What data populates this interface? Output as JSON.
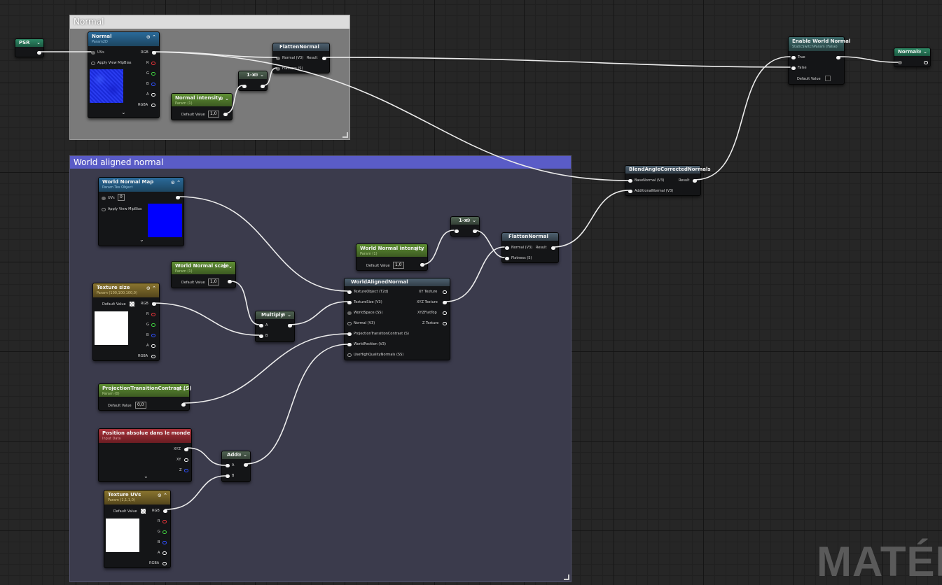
{
  "comments": {
    "normal": "Normal",
    "world": "World aligned normal"
  },
  "nodes": {
    "psr": {
      "title": "PSR"
    },
    "normal_tex": {
      "title": "Normal",
      "subtitle": "Param2D",
      "uvs": "UVs",
      "mip": "Apply View MipBias",
      "rgb": "RGB",
      "r": "R",
      "g": "G",
      "b": "B",
      "a": "A",
      "rgba": "RGBA"
    },
    "normal_intensity": {
      "title": "Normal intensity",
      "subtitle": "Param (1)",
      "default_label": "Default Value",
      "default_value": "1,0"
    },
    "one_minus_top": {
      "title": "1-x"
    },
    "flatten_top": {
      "title": "FlattenNormal",
      "in1": "Normal (V3)",
      "in2": "Flatness (S)",
      "out": "Result"
    },
    "enable_world": {
      "title": "Enable World Normal",
      "subtitle": "StaticSwitchParam (False)",
      "true_label": "True",
      "false_label": "False",
      "default_label": "Default Value"
    },
    "normal_out": {
      "title": "Normal"
    },
    "blend": {
      "title": "BlendAngleCorrectedNormals",
      "in1": "BaseNormal (V3)",
      "in2": "AdditionalNormal (V3)",
      "out": "Result"
    },
    "world_normal_map": {
      "title": "World Normal Map",
      "subtitle": "Param Tex Object",
      "uvs": "UVs",
      "uvs_value": "0",
      "mip": "Apply View MipBias"
    },
    "one_minus_world": {
      "title": "1-x"
    },
    "flatten_world": {
      "title": "FlattenNormal",
      "in1": "Normal (V3)",
      "in2": "Flatness (S)",
      "out": "Result"
    },
    "world_intensity": {
      "title": "World Normal intensity",
      "subtitle": "Param (1)",
      "default_label": "Default Value",
      "default_value": "1,0"
    },
    "world_scale": {
      "title": "World Normal scale",
      "subtitle": "Param (1)",
      "default_label": "Default Value",
      "default_value": "1,0"
    },
    "texture_size": {
      "title": "Texture size",
      "subtitle": "Param (100,100,100,0)",
      "default_label": "Default Value",
      "rgb": "RGB",
      "r": "R",
      "g": "G",
      "b": "B",
      "a": "A",
      "rgba": "RGBA"
    },
    "multiply": {
      "title": "Multiply",
      "a": "A",
      "b": "B"
    },
    "world_aligned": {
      "title": "WorldAlignedNormal",
      "inputs": [
        "TextureObject (T2d)",
        "TextureSize (V3)",
        "WorldSpace (SS)",
        "Normal (V3)",
        "ProjectionTransitionContrast (S)",
        "WorldPosition (V3)",
        "UseHighQualityNormals (SS)"
      ],
      "outputs": [
        "XY Texture",
        "XYZ Texture",
        "XYZFlatTop",
        "Z Texture"
      ]
    },
    "proj_contrast": {
      "title": "ProjectionTransitionContrast (S)",
      "subtitle": "Param (0)",
      "default_label": "Default Value",
      "default_value": "0,0"
    },
    "abs_world_pos": {
      "title": "Position absolue dans le monde",
      "subtitle": "Input Data",
      "xyz": "XYZ",
      "xy": "XY",
      "z": "Z"
    },
    "add": {
      "title": "Add",
      "a": "A",
      "b": "B"
    },
    "texture_uvs": {
      "title": "Texture UVs",
      "subtitle": "Param (1,1,1,0)",
      "default_label": "Default Value",
      "rgb": "RGB",
      "r": "R",
      "g": "G",
      "b": "B",
      "a": "A",
      "rgba": "RGBA"
    }
  },
  "watermark": "MATÉR",
  "colors": {
    "background": "#262626",
    "comment_normal": "#7a7a7a",
    "comment_world": "#3b3b4c",
    "comment_world_title": "#5a5cc7",
    "wire": "#f0f0f0"
  }
}
